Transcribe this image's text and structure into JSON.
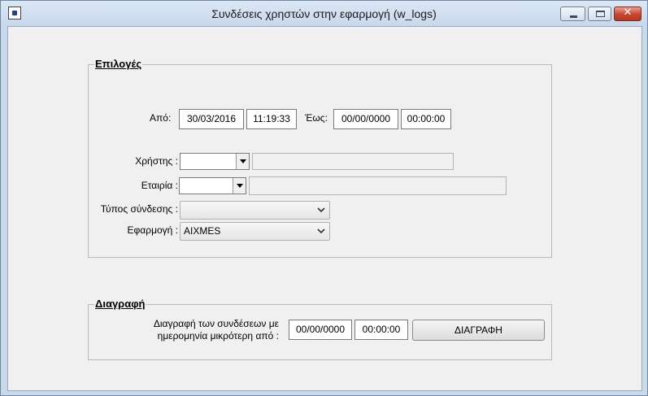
{
  "window": {
    "title": "Συνδέσεις χρηστών στην εφαρμογή   (w_logs)",
    "close_symbol": "✕",
    "icons": [
      "app-icon",
      "minimize-icon",
      "maximize-icon",
      "close-icon"
    ]
  },
  "options": {
    "title": "Επιλογές",
    "from_label": "Από:",
    "from_date": "30/03/2016",
    "from_time": "11:19:33",
    "to_label": "Έως:",
    "to_date": "00/00/0000",
    "to_time": "00:00:00",
    "user_label": "Χρήστης :",
    "user_code": "",
    "user_name": "",
    "company_label": "Εταιρία :",
    "company_code": "",
    "company_name": "",
    "connection_type_label": "Τύπος σύνδεσης :",
    "connection_type_value": "",
    "application_label": "Εφαρμογή :",
    "application_value": "AIXMES"
  },
  "delete": {
    "title": "Διαγραφή",
    "description_line1": "Διαγραφή των συνδέσεων με",
    "description_line2": "ημερομηνία μικρότερη από :",
    "date": "00/00/0000",
    "time": "00:00:00",
    "button_label": "ΔΙΑΓΡΑΦΗ"
  }
}
